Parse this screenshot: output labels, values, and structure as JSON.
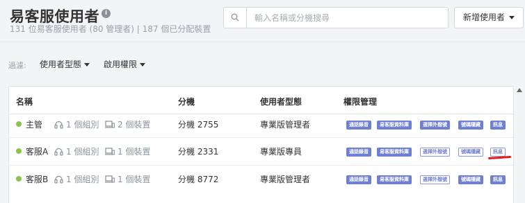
{
  "header": {
    "title": "易客服使用者",
    "info_icon": "i",
    "subtitle": "131 位易客服使用者 (80 管理者) | 187 個已分配裝置"
  },
  "search": {
    "placeholder": "輸入名稱或分機搜尋",
    "value": ""
  },
  "add_user_button": {
    "label": "新增使用者"
  },
  "filters": {
    "label": "過濾:",
    "user_type": "使用者型態",
    "permission": "啟用權限"
  },
  "table": {
    "columns": [
      "名稱",
      "分機",
      "使用者型態",
      "權限管理"
    ],
    "rows": [
      {
        "name": "主管",
        "groups": "1 個組別",
        "devices": "2 個裝置",
        "extension": "分機 2755",
        "user_type": "專業版管理者",
        "permissions": [
          {
            "label": "通話錄音",
            "on": true
          },
          {
            "label": "易客服資料庫",
            "on": true
          },
          {
            "label": "選擇外撥號",
            "on": true
          },
          {
            "label": "號碼隱藏",
            "on": true
          },
          {
            "label": "訊息",
            "on": true
          }
        ]
      },
      {
        "name": "客服A",
        "groups": "1 個組別",
        "devices": "1 個裝置",
        "extension": "分機 2331",
        "user_type": "專業版專員",
        "permissions": [
          {
            "label": "通話錄音",
            "on": true
          },
          {
            "label": "易客服資料庫",
            "on": true
          },
          {
            "label": "選擇外撥號",
            "on": false
          },
          {
            "label": "號碼隱藏",
            "on": false
          },
          {
            "label": "訊息",
            "on": false
          }
        ]
      },
      {
        "name": "客服B",
        "groups": "1 個組別",
        "devices": "1 個裝置",
        "extension": "分機 8772",
        "user_type": "專業版管理者",
        "permissions": [
          {
            "label": "通話錄音",
            "on": true
          },
          {
            "label": "易客服資料庫",
            "on": true
          },
          {
            "label": "選擇外撥號",
            "on": false
          },
          {
            "label": "號碼隱藏",
            "on": true
          },
          {
            "label": "訊息",
            "on": true
          }
        ]
      }
    ]
  },
  "colors": {
    "status_active": "#8bc34a",
    "permission_accent": "#6f7fd1",
    "annotation_mark": "#e01c1c"
  }
}
